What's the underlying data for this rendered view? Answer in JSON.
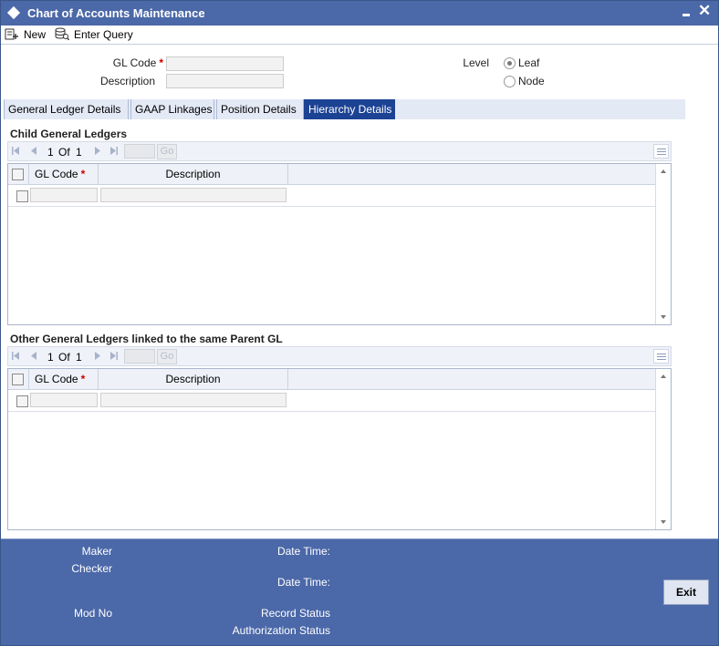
{
  "window": {
    "title": "Chart of Accounts Maintenance",
    "close_glyph": "✕"
  },
  "toolbar": {
    "new_label": "New",
    "enter_query_label": "Enter Query"
  },
  "header": {
    "gl_code_label": "GL Code",
    "required_mark": "*",
    "description_label": "Description",
    "gl_code_value": "",
    "description_value": "",
    "level_label": "Level",
    "level_options": [
      "Leaf",
      "Node"
    ],
    "level_selected": "Leaf"
  },
  "tabs": [
    {
      "label": "General Ledger Details",
      "active": false
    },
    {
      "label": "GAAP Linkages",
      "active": false
    },
    {
      "label": "Position Details",
      "active": false
    },
    {
      "label": "Hierarchy Details",
      "active": true
    }
  ],
  "sections": [
    {
      "title": "Child General Ledgers",
      "pager": {
        "current": "1",
        "of_label": "Of",
        "total": "1",
        "go_label": "Go"
      },
      "columns": [
        "GL Code",
        "Description"
      ],
      "rows": [
        {
          "gl_code": "",
          "description": ""
        }
      ]
    },
    {
      "title": "Other General Ledgers linked to the same Parent GL",
      "pager": {
        "current": "1",
        "of_label": "Of",
        "total": "1",
        "go_label": "Go"
      },
      "columns": [
        "GL Code",
        "Description"
      ],
      "rows": [
        {
          "gl_code": "",
          "description": ""
        }
      ]
    }
  ],
  "footer": {
    "maker_label": "Maker",
    "checker_label": "Checker",
    "date_time_label": "Date Time:",
    "mod_no_label": "Mod No",
    "record_status_label": "Record Status",
    "authorization_status_label": "Authorization Status",
    "exit_label": "Exit"
  },
  "colors": {
    "title_bar": "#4b68a8",
    "active_tab": "#1c4294",
    "tab_bar": "#e3e9f5",
    "required": "#cc0000"
  }
}
